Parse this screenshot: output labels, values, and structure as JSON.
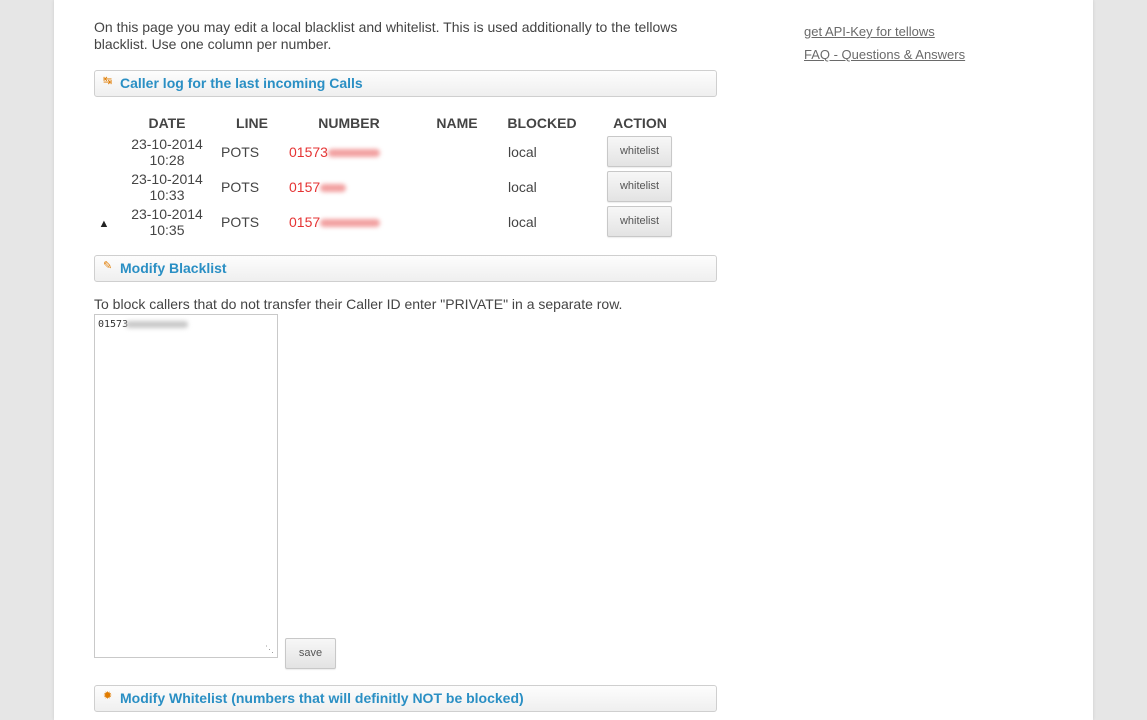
{
  "intro_text": "On this page you may edit a local blacklist and whitelist. This is used additionally to the tellows blacklist. Use one column per number.",
  "side_links": [
    "get API-Key for tellows",
    "FAQ - Questions & Answers"
  ],
  "caller_log": {
    "title": "Caller log for the last incoming Calls",
    "headers": [
      "DATE",
      "LINE",
      "NUMBER",
      "NAME",
      "BLOCKED",
      "ACTION"
    ],
    "rows": [
      {
        "warning": false,
        "date": "23-10-2014 10:28",
        "line": "POTS",
        "number": "01573",
        "name": "",
        "blocked": "local",
        "action": "whitelist"
      },
      {
        "warning": false,
        "date": "23-10-2014 10:33",
        "line": "POTS",
        "number": "0157",
        "name": "",
        "blocked": "local",
        "action": "whitelist"
      },
      {
        "warning": true,
        "date": "23-10-2014 10:35",
        "line": "POTS",
        "number": "0157",
        "name": "",
        "blocked": "local",
        "action": "whitelist"
      }
    ]
  },
  "blacklist": {
    "title": "Modify Blacklist",
    "note": "To block callers that do not transfer their Caller ID enter \"PRIVATE\" in a separate row.",
    "value": "01573",
    "save_label": "save"
  },
  "whitelist": {
    "title": "Modify Whitelist (numbers that will definitly NOT be blocked)"
  },
  "colors": {
    "accent_title": "#2a8fc4",
    "number_red": "#e53333",
    "icon_orange": "#e07b00"
  }
}
